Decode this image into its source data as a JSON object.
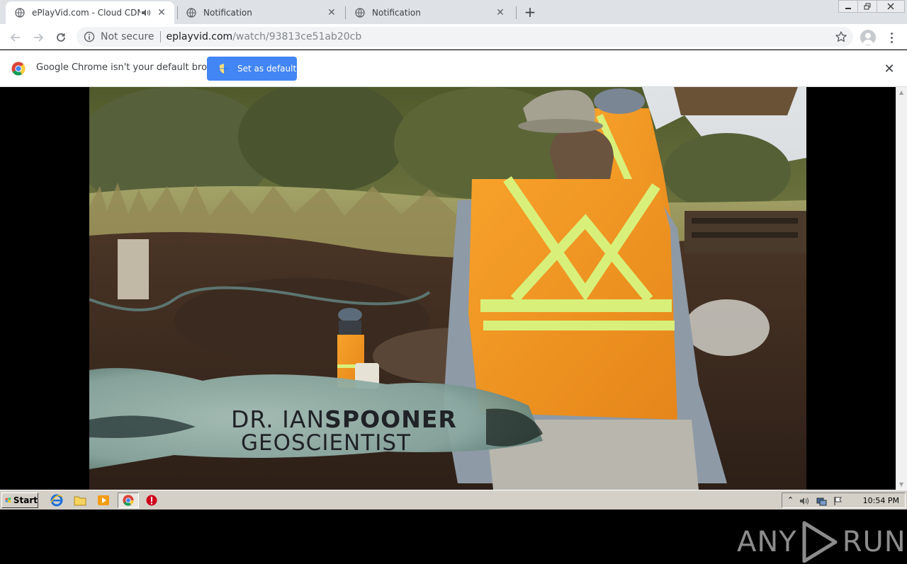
{
  "tabs": [
    {
      "title": "ePlayVid.com - Cloud CDN",
      "active": true,
      "audio": true
    },
    {
      "title": "Notification",
      "active": false
    },
    {
      "title": "Notification",
      "active": false
    }
  ],
  "address": {
    "security_label": "Not secure",
    "url_host": "eplayvid.com",
    "url_path": "/watch/93813ce51ab20cb"
  },
  "infobar": {
    "message": "Google Chrome isn't your default browser",
    "button_label": "Set as default"
  },
  "video": {
    "caption_name_first": "DR. IAN",
    "caption_name_last": "SPOONER",
    "caption_role": "GEOSCIENTIST",
    "watermark_left": "ANY",
    "watermark_right": "RUN"
  },
  "taskbar": {
    "start_label": "Start",
    "clock": "10:54 PM"
  },
  "colors": {
    "accent": "#4285f4",
    "tab_strip": "#dee1e6",
    "vest_orange": "#f39a1e",
    "reflective_stripe": "#d8f07a"
  }
}
